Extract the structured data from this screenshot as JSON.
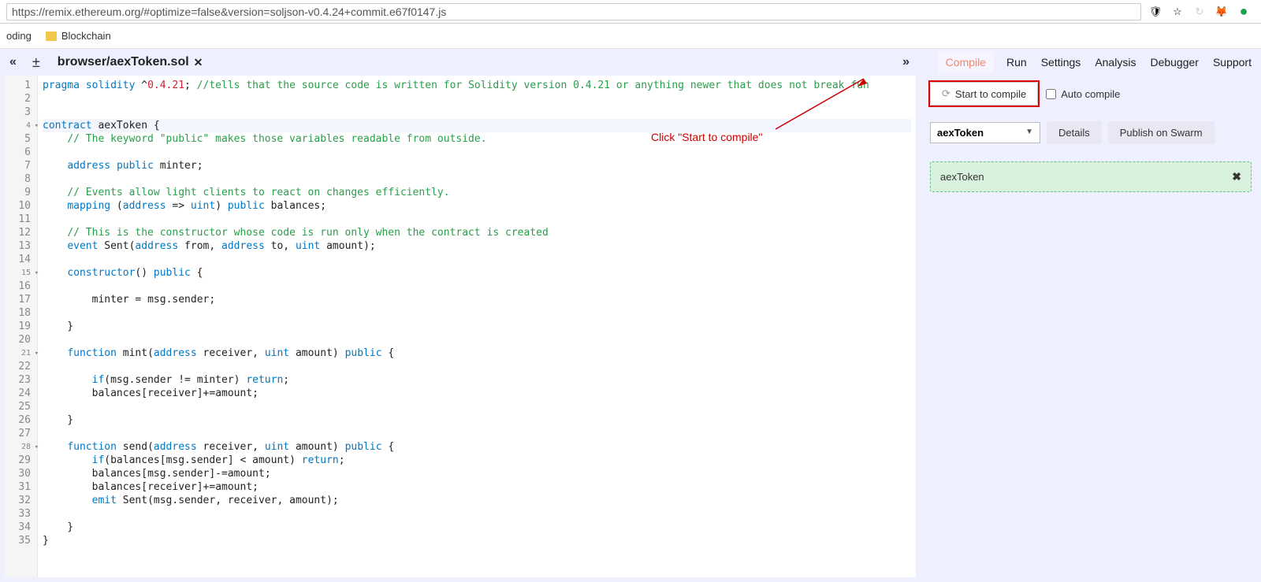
{
  "browser": {
    "url": "https://remix.ethereum.org/#optimize=false&version=soljson-v0.4.24+commit.e67f0147.js",
    "bookmarks": [
      "oding",
      "Blockchain"
    ]
  },
  "tabs": {
    "nav_left": "«",
    "new": "±",
    "overflow": "»",
    "file": "browser/aexToken.sol",
    "close": "✕"
  },
  "side": {
    "tabs": [
      "Compile",
      "Run",
      "Settings",
      "Analysis",
      "Debugger",
      "Support"
    ],
    "active_tab": "Compile",
    "compile_btn": "Start to compile",
    "auto_compile": "Auto compile",
    "contract_select": "aexToken",
    "details_btn": "Details",
    "publish_btn": "Publish on Swarm",
    "result_name": "aexToken",
    "result_close": "✖"
  },
  "annotation": {
    "text": "Click \"Start to compile\""
  },
  "code": {
    "lines": [
      {
        "n": 1,
        "fold": false,
        "hl": false,
        "tokens": [
          [
            "kw",
            "pragma"
          ],
          [
            "p",
            " "
          ],
          [
            "kw",
            "solidity"
          ],
          [
            "p",
            " ^"
          ],
          [
            "num",
            "0.4.21"
          ],
          [
            "p",
            "; "
          ],
          [
            "com",
            "//tells that the source code is written for Solidity version 0.4.21 or anything newer that does not break fun"
          ]
        ]
      },
      {
        "n": 2,
        "fold": false,
        "hl": false,
        "tokens": []
      },
      {
        "n": 3,
        "fold": false,
        "hl": false,
        "tokens": []
      },
      {
        "n": 4,
        "fold": true,
        "hl": true,
        "tokens": [
          [
            "kw",
            "contract"
          ],
          [
            "p",
            " "
          ],
          [
            "id",
            "aexToken"
          ],
          [
            "p",
            " {"
          ]
        ]
      },
      {
        "n": 5,
        "fold": false,
        "hl": false,
        "tokens": [
          [
            "p",
            "    "
          ],
          [
            "com",
            "// The keyword \"public\" makes those variables readable from outside."
          ]
        ]
      },
      {
        "n": 6,
        "fold": false,
        "hl": false,
        "tokens": []
      },
      {
        "n": 7,
        "fold": false,
        "hl": false,
        "tokens": [
          [
            "p",
            "    "
          ],
          [
            "type",
            "address"
          ],
          [
            "p",
            " "
          ],
          [
            "kw",
            "public"
          ],
          [
            "p",
            " "
          ],
          [
            "id",
            "minter"
          ],
          [
            "p",
            ";"
          ]
        ]
      },
      {
        "n": 8,
        "fold": false,
        "hl": false,
        "tokens": []
      },
      {
        "n": 9,
        "fold": false,
        "hl": false,
        "tokens": [
          [
            "p",
            "    "
          ],
          [
            "com",
            "// Events allow light clients to react on changes efficiently."
          ]
        ]
      },
      {
        "n": 10,
        "fold": false,
        "hl": false,
        "tokens": [
          [
            "p",
            "    "
          ],
          [
            "kw",
            "mapping"
          ],
          [
            "p",
            " ("
          ],
          [
            "type",
            "address"
          ],
          [
            "p",
            " => "
          ],
          [
            "type",
            "uint"
          ],
          [
            "p",
            ") "
          ],
          [
            "kw",
            "public"
          ],
          [
            "p",
            " "
          ],
          [
            "id",
            "balances"
          ],
          [
            "p",
            ";"
          ]
        ]
      },
      {
        "n": 11,
        "fold": false,
        "hl": false,
        "tokens": []
      },
      {
        "n": 12,
        "fold": false,
        "hl": false,
        "tokens": [
          [
            "p",
            "    "
          ],
          [
            "com",
            "// This is the constructor whose code is run only when the contract is created"
          ]
        ]
      },
      {
        "n": 13,
        "fold": false,
        "hl": false,
        "tokens": [
          [
            "p",
            "    "
          ],
          [
            "kw",
            "event"
          ],
          [
            "p",
            " "
          ],
          [
            "id",
            "Sent"
          ],
          [
            "p",
            "("
          ],
          [
            "type",
            "address"
          ],
          [
            "p",
            " "
          ],
          [
            "id",
            "from"
          ],
          [
            "p",
            ", "
          ],
          [
            "type",
            "address"
          ],
          [
            "p",
            " "
          ],
          [
            "id",
            "to"
          ],
          [
            "p",
            ", "
          ],
          [
            "type",
            "uint"
          ],
          [
            "p",
            " "
          ],
          [
            "id",
            "amount"
          ],
          [
            "p",
            ");"
          ]
        ]
      },
      {
        "n": 14,
        "fold": false,
        "hl": false,
        "tokens": []
      },
      {
        "n": 15,
        "fold": true,
        "hl": false,
        "tokens": [
          [
            "p",
            "    "
          ],
          [
            "kw",
            "constructor"
          ],
          [
            "p",
            "() "
          ],
          [
            "kw",
            "public"
          ],
          [
            "p",
            " {"
          ]
        ]
      },
      {
        "n": 16,
        "fold": false,
        "hl": false,
        "tokens": []
      },
      {
        "n": 17,
        "fold": false,
        "hl": false,
        "tokens": [
          [
            "p",
            "        "
          ],
          [
            "id",
            "minter"
          ],
          [
            "p",
            " = "
          ],
          [
            "id",
            "msg"
          ],
          [
            "p",
            "."
          ],
          [
            "id",
            "sender"
          ],
          [
            "p",
            ";"
          ]
        ]
      },
      {
        "n": 18,
        "fold": false,
        "hl": false,
        "tokens": []
      },
      {
        "n": 19,
        "fold": false,
        "hl": false,
        "tokens": [
          [
            "p",
            "    }"
          ]
        ]
      },
      {
        "n": 20,
        "fold": false,
        "hl": false,
        "tokens": []
      },
      {
        "n": 21,
        "fold": true,
        "hl": false,
        "tokens": [
          [
            "p",
            "    "
          ],
          [
            "kw",
            "function"
          ],
          [
            "p",
            " "
          ],
          [
            "id",
            "mint"
          ],
          [
            "p",
            "("
          ],
          [
            "type",
            "address"
          ],
          [
            "p",
            " "
          ],
          [
            "id",
            "receiver"
          ],
          [
            "p",
            ", "
          ],
          [
            "type",
            "uint"
          ],
          [
            "p",
            " "
          ],
          [
            "id",
            "amount"
          ],
          [
            "p",
            ") "
          ],
          [
            "kw",
            "public"
          ],
          [
            "p",
            " {"
          ]
        ]
      },
      {
        "n": 22,
        "fold": false,
        "hl": false,
        "tokens": []
      },
      {
        "n": 23,
        "fold": false,
        "hl": false,
        "tokens": [
          [
            "p",
            "        "
          ],
          [
            "kw",
            "if"
          ],
          [
            "p",
            "("
          ],
          [
            "id",
            "msg"
          ],
          [
            "p",
            "."
          ],
          [
            "id",
            "sender"
          ],
          [
            "p",
            " != "
          ],
          [
            "id",
            "minter"
          ],
          [
            "p",
            ") "
          ],
          [
            "kw",
            "return"
          ],
          [
            "p",
            ";"
          ]
        ]
      },
      {
        "n": 24,
        "fold": false,
        "hl": false,
        "tokens": [
          [
            "p",
            "        "
          ],
          [
            "id",
            "balances"
          ],
          [
            "p",
            "["
          ],
          [
            "id",
            "receiver"
          ],
          [
            "p",
            "]+="
          ],
          [
            "id",
            "amount"
          ],
          [
            "p",
            ";"
          ]
        ]
      },
      {
        "n": 25,
        "fold": false,
        "hl": false,
        "tokens": []
      },
      {
        "n": 26,
        "fold": false,
        "hl": false,
        "tokens": [
          [
            "p",
            "    }"
          ]
        ]
      },
      {
        "n": 27,
        "fold": false,
        "hl": false,
        "tokens": []
      },
      {
        "n": 28,
        "fold": true,
        "hl": false,
        "tokens": [
          [
            "p",
            "    "
          ],
          [
            "kw",
            "function"
          ],
          [
            "p",
            " "
          ],
          [
            "id",
            "send"
          ],
          [
            "p",
            "("
          ],
          [
            "type",
            "address"
          ],
          [
            "p",
            " "
          ],
          [
            "id",
            "receiver"
          ],
          [
            "p",
            ", "
          ],
          [
            "type",
            "uint"
          ],
          [
            "p",
            " "
          ],
          [
            "id",
            "amount"
          ],
          [
            "p",
            ") "
          ],
          [
            "kw",
            "public"
          ],
          [
            "p",
            " {"
          ]
        ]
      },
      {
        "n": 29,
        "fold": false,
        "hl": false,
        "tokens": [
          [
            "p",
            "        "
          ],
          [
            "kw",
            "if"
          ],
          [
            "p",
            "("
          ],
          [
            "id",
            "balances"
          ],
          [
            "p",
            "["
          ],
          [
            "id",
            "msg"
          ],
          [
            "p",
            "."
          ],
          [
            "id",
            "sender"
          ],
          [
            "p",
            "] < "
          ],
          [
            "id",
            "amount"
          ],
          [
            "p",
            ") "
          ],
          [
            "kw",
            "return"
          ],
          [
            "p",
            ";"
          ]
        ]
      },
      {
        "n": 30,
        "fold": false,
        "hl": false,
        "tokens": [
          [
            "p",
            "        "
          ],
          [
            "id",
            "balances"
          ],
          [
            "p",
            "["
          ],
          [
            "id",
            "msg"
          ],
          [
            "p",
            "."
          ],
          [
            "id",
            "sender"
          ],
          [
            "p",
            "]-="
          ],
          [
            "id",
            "amount"
          ],
          [
            "p",
            ";"
          ]
        ]
      },
      {
        "n": 31,
        "fold": false,
        "hl": false,
        "tokens": [
          [
            "p",
            "        "
          ],
          [
            "id",
            "balances"
          ],
          [
            "p",
            "["
          ],
          [
            "id",
            "receiver"
          ],
          [
            "p",
            "]+="
          ],
          [
            "id",
            "amount"
          ],
          [
            "p",
            ";"
          ]
        ]
      },
      {
        "n": 32,
        "fold": false,
        "hl": false,
        "tokens": [
          [
            "p",
            "        "
          ],
          [
            "kw",
            "emit"
          ],
          [
            "p",
            " "
          ],
          [
            "id",
            "Sent"
          ],
          [
            "p",
            "("
          ],
          [
            "id",
            "msg"
          ],
          [
            "p",
            "."
          ],
          [
            "id",
            "sender"
          ],
          [
            "p",
            ", "
          ],
          [
            "id",
            "receiver"
          ],
          [
            "p",
            ", "
          ],
          [
            "id",
            "amount"
          ],
          [
            "p",
            ");"
          ]
        ]
      },
      {
        "n": 33,
        "fold": false,
        "hl": false,
        "tokens": []
      },
      {
        "n": 34,
        "fold": false,
        "hl": false,
        "tokens": [
          [
            "p",
            "    }"
          ]
        ]
      },
      {
        "n": 35,
        "fold": false,
        "hl": false,
        "tokens": [
          [
            "p",
            "}"
          ]
        ]
      }
    ]
  }
}
